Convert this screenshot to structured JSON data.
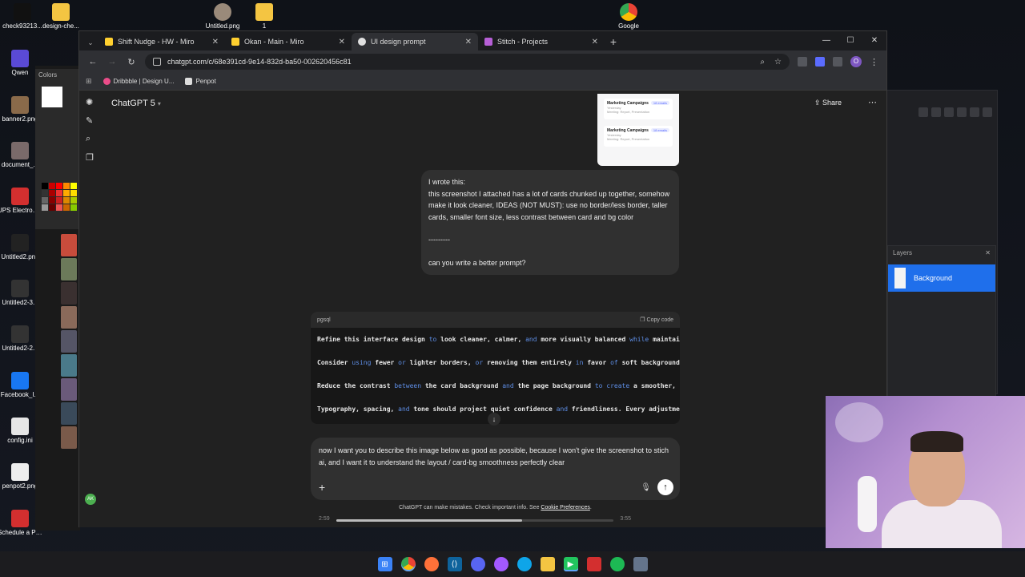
{
  "desktop": {
    "icons_left": [
      {
        "label": "check93213...",
        "color": "#111111"
      },
      {
        "label": "Qwen",
        "color": "#5a4ad6"
      },
      {
        "label": "banner2.png",
        "color": "#8a6a4a"
      },
      {
        "label": "document_...",
        "color": "#7a6a6a"
      },
      {
        "label": "UPS Electronic R...",
        "color": "#d32f2f"
      },
      {
        "label": "Untitled2.png",
        "color": "#222222"
      },
      {
        "label": "Untitled2-3...",
        "color": "#333333"
      },
      {
        "label": "Untitled2-2...",
        "color": "#333333"
      },
      {
        "label": "Facebook_I...",
        "color": "#1877f2"
      },
      {
        "label": "config.ini",
        "color": "#e6e6e6"
      },
      {
        "label": "penpot2.png",
        "color": "#eeeeee"
      },
      {
        "label": "Schedule a Parcel Coll...",
        "color": "#d32f2f"
      }
    ],
    "icons_top": [
      {
        "label": "design-che...",
        "color": "#f4c542"
      },
      {
        "label": "Untitled.png",
        "color": "#9a8a7a"
      },
      {
        "label": "1",
        "color": "#f4c542"
      },
      {
        "label": "Google",
        "color": "#ea4335"
      }
    ]
  },
  "colors_panel": {
    "title": "Colors"
  },
  "layers_panel": {
    "title": "Layers",
    "item": "Background"
  },
  "browser": {
    "tabs": [
      {
        "title": "Shift Nudge - HW - Miro",
        "color": "#ffd02f",
        "active": false
      },
      {
        "title": "Okan - Main - Miro",
        "color": "#ffd02f",
        "active": false
      },
      {
        "title": "UI design prompt",
        "color": "#e0e0e0",
        "active": true
      },
      {
        "title": "Stitch - Projects",
        "color": "#b65fd6",
        "active": false
      }
    ],
    "url": "chatgpt.com/c/68e391cd-9e14-832d-ba50-002620456c81",
    "profile_initial": "O",
    "bookmarks": [
      {
        "label": "Dribbble | Design U...",
        "color": "#ea4c89"
      },
      {
        "label": "Penpot",
        "color": "#dddddd"
      }
    ]
  },
  "chat": {
    "model": "ChatGPT 5",
    "share_label": "Share",
    "thumb_rows": [
      {
        "title": "Marketing Campaigns",
        "sub": "Yesterday",
        "meta": "Meeting: Report, Presentation",
        "pill": "18 emails"
      },
      {
        "title": "Marketing Campaigns",
        "sub": "Yesterday",
        "meta": "Meeting: Report, Presentation",
        "pill": "18 emails"
      }
    ],
    "user_message": [
      "I wrote this:",
      "this screenshot I attached has a lot of cards chunked up together, somehow make it look cleaner, IDEAS (NOT MUST): use no border/less border, taller cards, smaller font size, less contrast between card and bg color",
      "",
      "---------",
      "",
      "can you write a better prompt?"
    ],
    "code": {
      "lang": "pgsql",
      "copy_label": "Copy code",
      "lines": [
        "Refine this interface design to look cleaner, calmer, and more visually balanced while maintaining",
        "Consider using fewer or lighter borders, or removing them entirely in favor of soft background con",
        "Reduce the contrast between the card background and the page background to create a smoother, more",
        "Typography, spacing, and tone should project quiet confidence and friendliness. Every adjustment s"
      ]
    },
    "composer_text": "now I want you to describe this image below as good as possible, because I won't give the screenshot to stich ai, and I want it to understand the layout / card-bg smoothness perfectly clear",
    "disclaimer": "ChatGPT can make mistakes. Check important info. See",
    "disclaimer_link": "Cookie Preferences",
    "disclaimer_end": "."
  },
  "video": {
    "elapsed": "2:59",
    "duration": "3:55",
    "progress": 0.67
  }
}
